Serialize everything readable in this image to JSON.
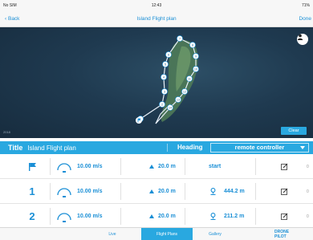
{
  "status_bar": {
    "carrier": "No SIM",
    "time": "12:43",
    "battery": "71%"
  },
  "nav": {
    "back": "Back",
    "title": "Island Flight plan",
    "done": "Done"
  },
  "map": {
    "clear_label": "Clear",
    "waypoint_labels": [
      "1",
      "2",
      "3",
      "4",
      "5",
      "6",
      "7",
      "8",
      "9",
      "10",
      "11",
      "12",
      "13",
      "14"
    ],
    "credit": "2018"
  },
  "plan_header": {
    "title_label": "Title",
    "title_value": "Island Flight plan",
    "heading_label": "Heading",
    "heading_value": "remote controller"
  },
  "waypoints": [
    {
      "index": "",
      "icon": "flag-icon",
      "speed": "10.00 m/s",
      "altitude": "20.0 m",
      "distance": "start",
      "extra": "0"
    },
    {
      "index": "1",
      "icon": "",
      "speed": "10.00 m/s",
      "altitude": "20.0 m",
      "distance": "444.2 m",
      "extra": "0"
    },
    {
      "index": "2",
      "icon": "",
      "speed": "10.00 m/s",
      "altitude": "20.0 m",
      "distance": "211.2 m",
      "extra": "0"
    }
  ],
  "tabs": [
    {
      "label": "Live",
      "active": false
    },
    {
      "label": "Flight Plans",
      "active": true
    },
    {
      "label": "Gallery",
      "active": false
    }
  ],
  "brand": {
    "line1": "DRONE",
    "line2": "PILOT"
  },
  "colors": {
    "accent": "#29a8e0",
    "text_blue": "#1a8fd6",
    "water": "#1f3a50",
    "island": "#4e7a58"
  }
}
